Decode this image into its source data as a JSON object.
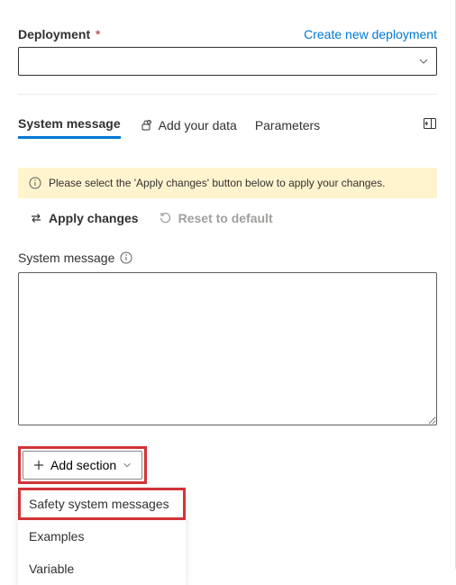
{
  "deployment": {
    "label": "Deployment",
    "required_marker": "*",
    "link_text": "Create new deployment",
    "selected_value": ""
  },
  "tabs": {
    "items": [
      {
        "label": "System message"
      },
      {
        "label": "Add your data"
      },
      {
        "label": "Parameters"
      }
    ]
  },
  "banner": {
    "text": "Please select the 'Apply changes' button below to apply your changes."
  },
  "actions": {
    "apply": "Apply changes",
    "reset": "Reset to default"
  },
  "system_message": {
    "label": "System message",
    "value": ""
  },
  "add_section": {
    "button_label": "Add section",
    "options": [
      "Safety system messages",
      "Examples",
      "Variable"
    ]
  }
}
